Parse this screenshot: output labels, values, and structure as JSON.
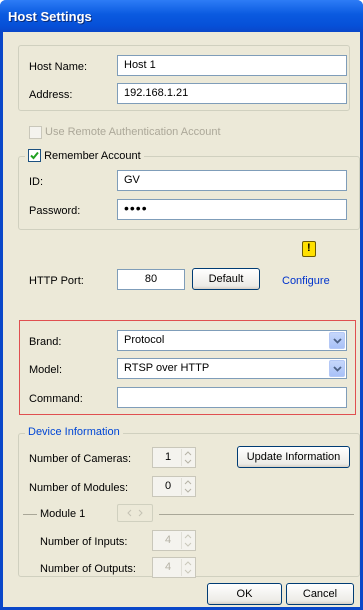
{
  "window": {
    "title": "Host Settings"
  },
  "host": {
    "name_label": "Host Name:",
    "name_value": "Host 1",
    "address_label": "Address:",
    "address_value": "192.168.1.21"
  },
  "auth": {
    "use_remote_label": "Use Remote Authentication Account",
    "use_remote_checked": false,
    "remember_label": "Remember Account",
    "remember_checked": true,
    "id_label": "ID:",
    "id_value": "GV",
    "password_label": "Password:",
    "password_value": "••••"
  },
  "http": {
    "warning_icon": "exclamation-warning-icon",
    "port_label": "HTTP Port:",
    "port_value": "80",
    "default_button": "Default",
    "configure_link": "Configure"
  },
  "stream": {
    "brand_label": "Brand:",
    "brand_value": "Protocol",
    "model_label": "Model:",
    "model_value": "RTSP over HTTP",
    "command_label": "Command:",
    "command_value": "",
    "highlight_color": "#e05050"
  },
  "device": {
    "legend": "Device Information",
    "cameras_label": "Number of Cameras:",
    "cameras_value": "1",
    "update_button": "Update Information",
    "modules_label": "Number of Modules:",
    "modules_value": "0",
    "module_name": "Module 1",
    "inputs_label": "Number of Inputs:",
    "inputs_value": "4",
    "outputs_label": "Number of Outputs:",
    "outputs_value": "4"
  },
  "footer": {
    "ok_button": "OK",
    "cancel_button": "Cancel"
  },
  "colors": {
    "title_bar": "#0a5ae0",
    "link": "#0033cc",
    "window_bg": "#ece9d8"
  }
}
